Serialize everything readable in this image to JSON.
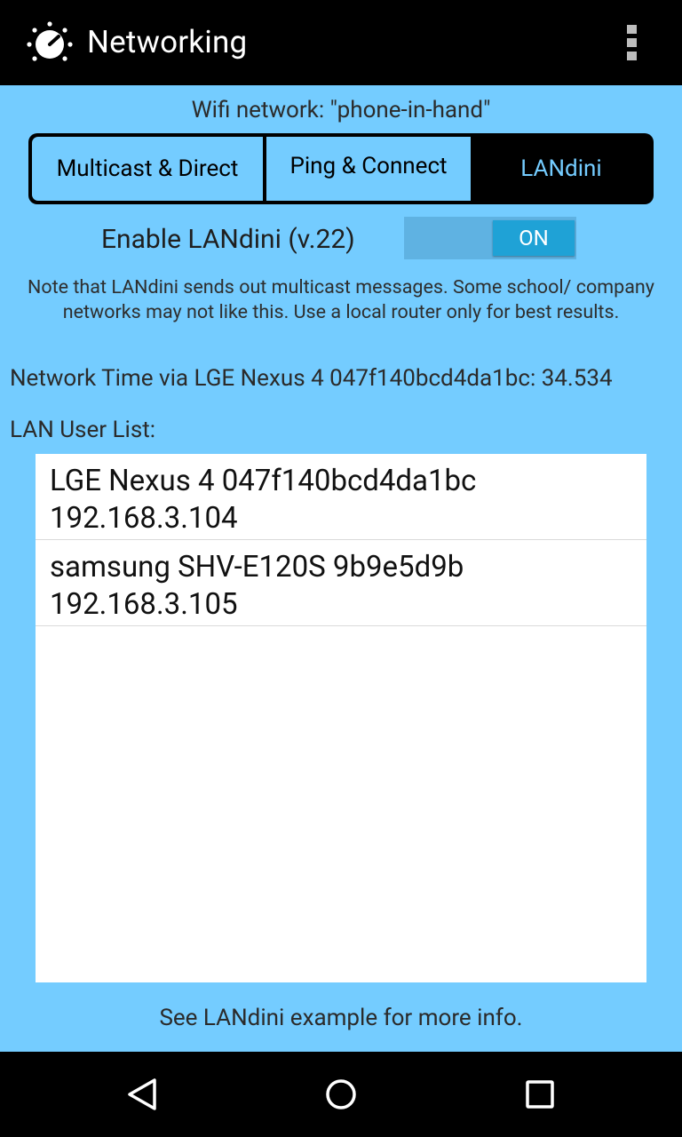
{
  "action_bar": {
    "title": "Networking",
    "app_icon": "timer-knob-icon",
    "overflow_icon": "more-vert-icon"
  },
  "wifi": {
    "text": "Wifi network: \"phone-in-hand\""
  },
  "tabs": [
    {
      "label": "Multicast & Direct",
      "selected": false
    },
    {
      "label": "Ping & Connect",
      "selected": false
    },
    {
      "label": "LANdini",
      "selected": true
    }
  ],
  "landini": {
    "enable_label": "Enable LANdini (v.22)",
    "toggle_state": "ON",
    "note": "Note that LANdini sends out multicast messages. Some school/ company networks may not like this. Use a local router only for best results.",
    "network_time": "Network Time via LGE Nexus 4 047f140bcd4da1bc: 34.534",
    "user_list_label": "LAN User List:",
    "users": [
      {
        "name": "LGE Nexus 4 047f140bcd4da1bc",
        "ip": "192.168.3.104"
      },
      {
        "name": "samsung SHV-E120S 9b9e5d9b",
        "ip": "192.168.3.105"
      }
    ],
    "footer": "See LANdini example for more info."
  },
  "nav": {
    "back_icon": "back-triangle-icon",
    "home_icon": "home-circle-icon",
    "recents_icon": "recents-square-icon"
  },
  "colors": {
    "background": "#74CCFF",
    "bar": "#000000",
    "toggle_on": "#1FA2D6",
    "tab_selected_text": "#74CCFF"
  }
}
